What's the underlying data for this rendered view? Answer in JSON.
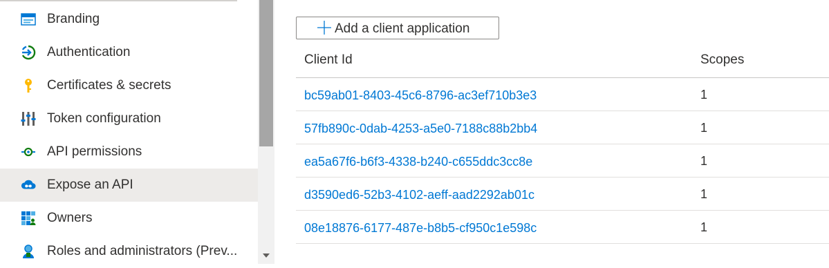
{
  "sidebar": {
    "items": [
      {
        "label": "Branding",
        "icon": "branding-icon",
        "selected": false
      },
      {
        "label": "Authentication",
        "icon": "authentication-icon",
        "selected": false
      },
      {
        "label": "Certificates & secrets",
        "icon": "key-icon",
        "selected": false
      },
      {
        "label": "Token configuration",
        "icon": "token-config-icon",
        "selected": false
      },
      {
        "label": "API permissions",
        "icon": "api-permissions-icon",
        "selected": false
      },
      {
        "label": "Expose an API",
        "icon": "cloud-api-icon",
        "selected": true
      },
      {
        "label": "Owners",
        "icon": "owners-icon",
        "selected": false
      },
      {
        "label": "Roles and administrators (Prev...",
        "icon": "roles-icon",
        "selected": false
      }
    ]
  },
  "main": {
    "add_button_label": "Add a client application",
    "table": {
      "columns": [
        "Client Id",
        "Scopes"
      ],
      "rows": [
        {
          "client_id": "bc59ab01-8403-45c6-8796-ac3ef710b3e3",
          "scopes": "1"
        },
        {
          "client_id": "57fb890c-0dab-4253-a5e0-7188c88b2bb4",
          "scopes": "1"
        },
        {
          "client_id": "ea5a67f6-b6f3-4338-b240-c655ddc3cc8e",
          "scopes": "1"
        },
        {
          "client_id": "d3590ed6-52b3-4102-aeff-aad2292ab01c",
          "scopes": "1"
        },
        {
          "client_id": "08e18876-6177-487e-b8b5-cf950c1e598c",
          "scopes": "1"
        }
      ]
    }
  },
  "colors": {
    "link": "#0078d4",
    "selected_bg": "#edebe9",
    "text": "#323130"
  }
}
